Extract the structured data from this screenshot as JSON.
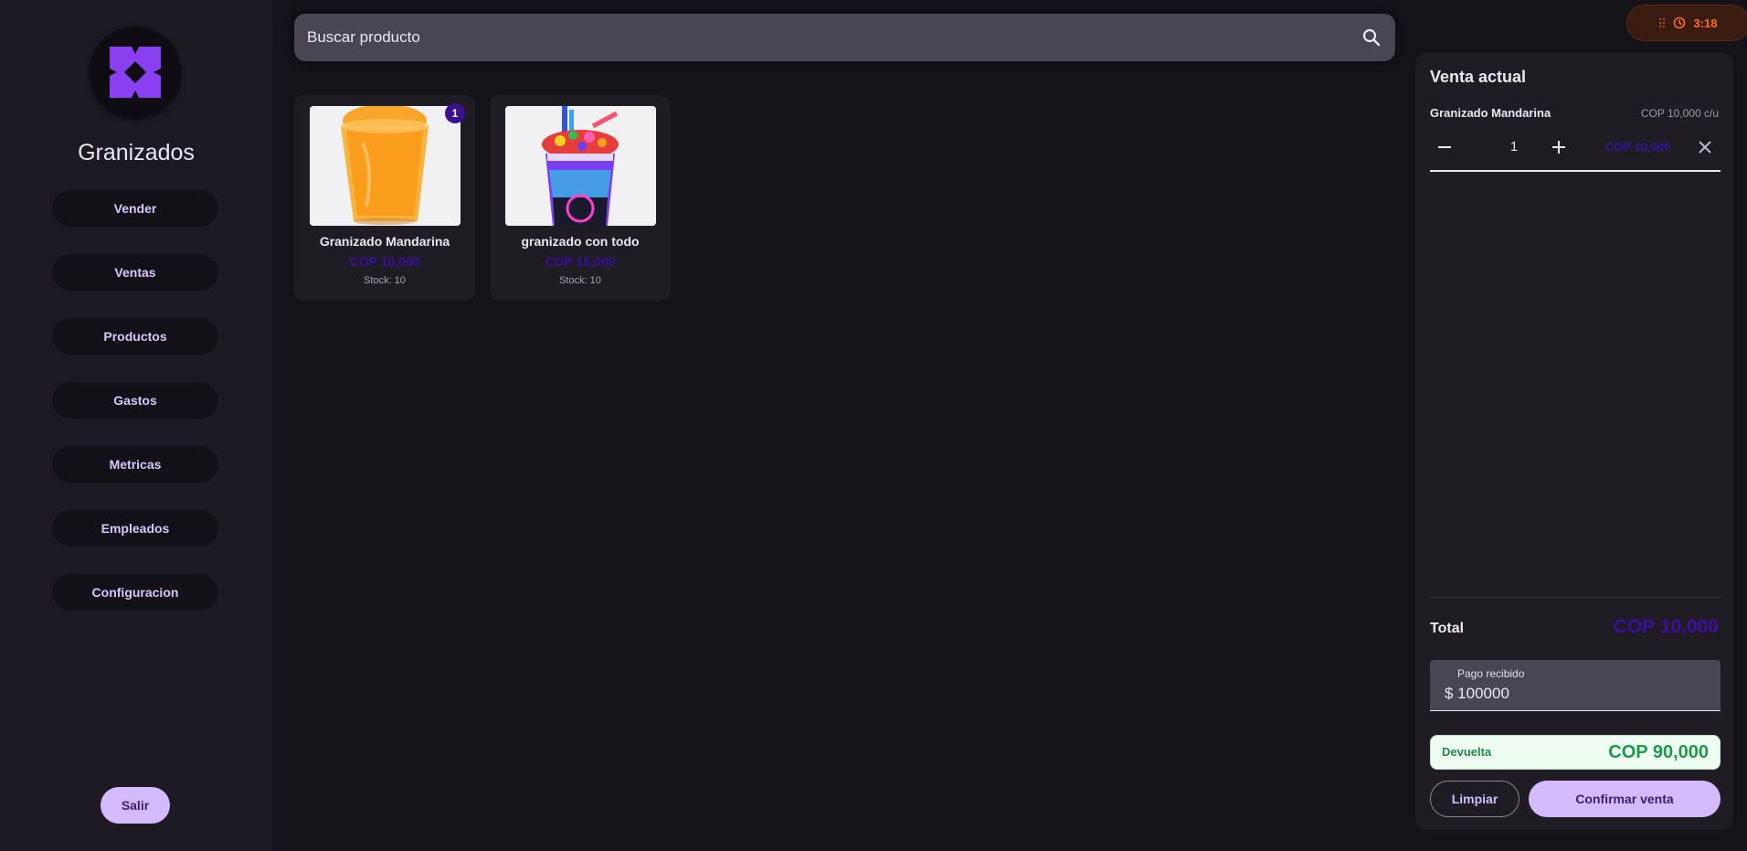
{
  "sidebar": {
    "brand_name": "Granizados",
    "nav_items": [
      {
        "label": "Vender"
      },
      {
        "label": "Ventas"
      },
      {
        "label": "Productos"
      },
      {
        "label": "Gastos"
      },
      {
        "label": "Metricas"
      },
      {
        "label": "Empleados"
      },
      {
        "label": "Configuracion"
      }
    ],
    "logout_label": "Salir",
    "logo_icon": "x-logo-icon"
  },
  "search": {
    "placeholder": "Buscar producto",
    "value": "",
    "icon": "search-icon"
  },
  "products": [
    {
      "name": "Granizado Mandarina",
      "price": "COP 10,000",
      "stock": "Stock: 10",
      "in_cart_qty": "1"
    },
    {
      "name": "granizado con todo",
      "price": "COP 15,000",
      "stock": "Stock: 10"
    }
  ],
  "timer": {
    "value": "3:18",
    "icons": [
      "drag-handle-icon",
      "clock-icon"
    ]
  },
  "sale": {
    "title": "Venta actual",
    "items": [
      {
        "name": "Granizado Mandarina",
        "unit_price": "COP 10,000 c/u",
        "quantity": "1",
        "subtotal": "COP 10,000"
      }
    ],
    "total_label": "Total",
    "total_value": "COP 10,000",
    "payment_label": "Pago recibido",
    "payment_value": "$ 100000",
    "change_label": "Devuelta",
    "change_value": "COP 90,000",
    "clear_label": "Limpiar",
    "confirm_label": "Confirmar venta"
  },
  "colors": {
    "accent": "#d4bbff",
    "price": "#3b0fa1",
    "change_green": "#1b9a4a",
    "timer_orange": "#ff6b1a",
    "background": "#151219",
    "sidebar": "#1d1a23"
  }
}
